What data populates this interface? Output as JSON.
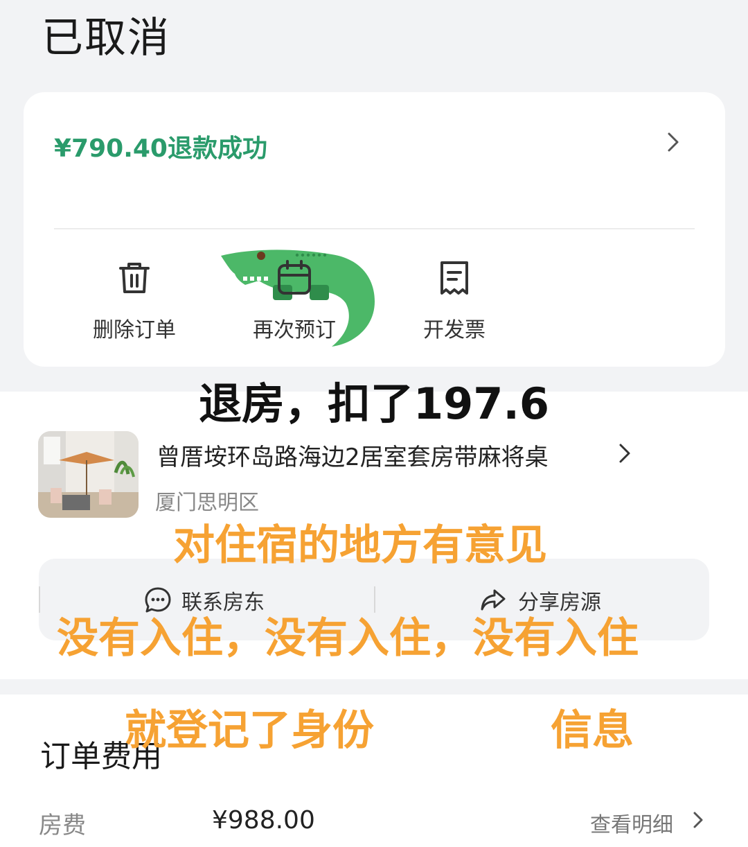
{
  "header": {
    "title": "已取消"
  },
  "refund": {
    "text": "¥790.40退款成功"
  },
  "actions": [
    {
      "label": "删除订单",
      "icon": "trash-icon"
    },
    {
      "label": "再次预订",
      "icon": "calendar-icon"
    },
    {
      "label": "开发票",
      "icon": "receipt-icon"
    }
  ],
  "listing": {
    "title": "曾厝垵环岛路海边2居室套房带麻将桌",
    "district": "厦门思明区"
  },
  "contact_bar": {
    "contact_label": "联系房东",
    "share_label": "分享房源"
  },
  "fees": {
    "section_title": "订单费用",
    "room_fee_label": "房费",
    "room_fee_amount": "¥988.00",
    "detail_label": "查看明细"
  },
  "annotations": {
    "black_caption": "退房，扣了197.6",
    "orange_line1": "对住宿的地方有意见",
    "orange_line2": "没有入住，没有入住，没有入住",
    "orange_line3a": "就登记了身份",
    "orange_line3b": "信息"
  },
  "colors": {
    "refund_green": "#2a9b6b",
    "annotation_orange": "#f6a233",
    "background_gray": "#f2f3f5"
  }
}
